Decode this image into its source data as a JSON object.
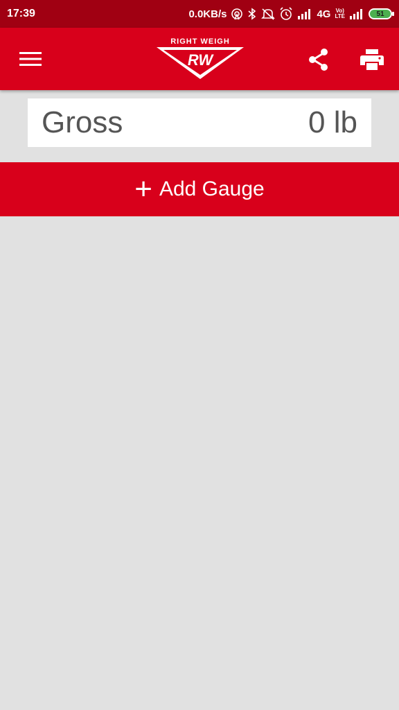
{
  "status_bar": {
    "time": "17:39",
    "network_speed": "0.0KB/s",
    "network_type": "4G",
    "volte_top": "Vo)",
    "volte_bottom": "LTE",
    "battery_level": "51"
  },
  "app_bar": {
    "logo_top_text": "RIGHT WEIGH",
    "logo_letters": "RW"
  },
  "gross": {
    "label": "Gross",
    "value": "0 lb"
  },
  "add_gauge": {
    "icon": "+",
    "label": "Add Gauge"
  },
  "colors": {
    "status_bar": "#a00012",
    "app_bar": "#d8001b",
    "background": "#e1e1e1",
    "card": "#ffffff",
    "text_gray": "#555555"
  },
  "icons": [
    "menu-icon",
    "share-icon",
    "print-icon",
    "plus-icon"
  ]
}
